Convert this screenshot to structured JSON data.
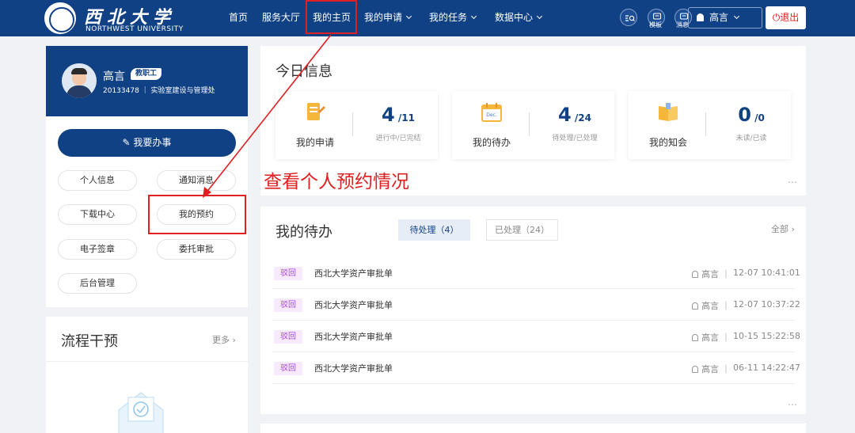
{
  "brand": {
    "name_cn": "西北大学",
    "name_en": "NORTHWEST UNIVERSITY"
  },
  "nav": {
    "items": [
      {
        "label": "首页",
        "has_menu": false
      },
      {
        "label": "服务大厅",
        "has_menu": false
      },
      {
        "label": "我的主页",
        "has_menu": false,
        "active": true
      },
      {
        "label": "我的申请",
        "has_menu": true
      },
      {
        "label": "我的任务",
        "has_menu": true
      },
      {
        "label": "数据中心",
        "has_menu": true
      }
    ],
    "tool_template_label": "模板",
    "tool_message_label": "消息",
    "user_label": "高言",
    "logout_label": "退出"
  },
  "profile": {
    "name": "高言",
    "badge": "教职工",
    "meta": "20133478 ｜ 实验室建设与管理处",
    "action_label": "我要办事",
    "menu": [
      "个人信息",
      "通知消息",
      "下载中心",
      "我的预约",
      "电子签章",
      "委托审批",
      "后台管理"
    ]
  },
  "flow": {
    "title": "流程干预",
    "more_label": "更多"
  },
  "today": {
    "title": "今日信息",
    "cards": [
      {
        "label": "我的申请",
        "count": "4",
        "total": "/11",
        "sub": "进行中/已完结",
        "icon": "application-icon"
      },
      {
        "label": "我的待办",
        "count": "4",
        "total": "/24",
        "sub": "待处理/已处理",
        "icon": "calendar-icon"
      },
      {
        "label": "我的知会",
        "count": "0",
        "total": "/0",
        "sub": "未读/已读",
        "icon": "book-icon"
      }
    ],
    "more_dots": "…"
  },
  "annotation": {
    "text": "查看个人预约情况",
    "color": "#e02020"
  },
  "pending": {
    "title": "我的待办",
    "tab_active": "待处理（4）",
    "tab_inactive": "已处理（24）",
    "all_label": "全部",
    "rows": [
      {
        "tag": "驳回",
        "title": "西北大学资产审批单",
        "user": "高言",
        "time": "12-07 10:41:01"
      },
      {
        "tag": "驳回",
        "title": "西北大学资产审批单",
        "user": "高言",
        "time": "12-07 10:37:22"
      },
      {
        "tag": "驳回",
        "title": "西北大学资产审批单",
        "user": "高言",
        "time": "10-15 15:22:58"
      },
      {
        "tag": "驳回",
        "title": "西北大学资产审批单",
        "user": "高言",
        "time": "06-11 14:22:47"
      }
    ],
    "more_dots": "…"
  },
  "colors": {
    "primary": "#114185",
    "accent_red": "#e02020",
    "tag_purple": "#a845d6",
    "page_bg": "#f1f2f5"
  }
}
